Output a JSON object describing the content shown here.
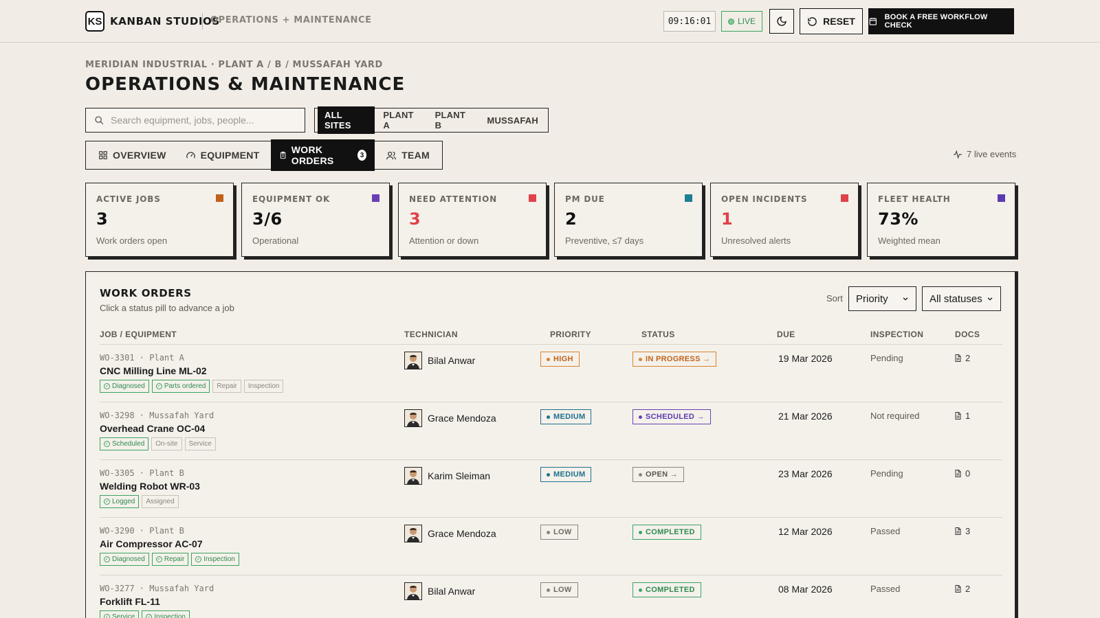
{
  "brand": {
    "logo": "KS",
    "name": "KANBAN STUDIOS",
    "section": "OPERATIONS + MAINTENANCE"
  },
  "topbar": {
    "clock": "09:16:01",
    "live": "LIVE",
    "reset": "RESET",
    "book": "BOOK A FREE WORKFLOW CHECK"
  },
  "breadcrumb": "MERIDIAN INDUSTRIAL · PLANT A / B / MUSSAFAH YARD",
  "title": "OPERATIONS & MAINTENANCE",
  "search": {
    "placeholder": "Search equipment, jobs, people..."
  },
  "sites": [
    "ALL SITES",
    "PLANT A",
    "PLANT B",
    "MUSSAFAH"
  ],
  "tabs": {
    "overview": "OVERVIEW",
    "equipment": "EQUIPMENT",
    "work_orders": "WORK ORDERS",
    "work_orders_count": "3",
    "team": "TEAM"
  },
  "live_events": "7 live events",
  "stats": [
    {
      "label": "ACTIVE JOBS",
      "value": "3",
      "sub": "Work orders open",
      "color": "#c0621a",
      "value_color": "#111111"
    },
    {
      "label": "EQUIPMENT OK",
      "value": "3/6",
      "sub": "Operational",
      "color": "#6a3fb5",
      "value_color": "#111111"
    },
    {
      "label": "NEED ATTENTION",
      "value": "3",
      "sub": "Attention or down",
      "color": "#e0424a",
      "value_color": "#e0424a"
    },
    {
      "label": "PM DUE",
      "value": "2",
      "sub": "Preventive, ≤7 days",
      "color": "#1f7f95",
      "value_color": "#111111"
    },
    {
      "label": "OPEN INCIDENTS",
      "value": "1",
      "sub": "Unresolved alerts",
      "color": "#e0424a",
      "value_color": "#e0424a"
    },
    {
      "label": "FLEET HEALTH",
      "value": "73%",
      "sub": "Weighted mean",
      "color": "#5a3bb0",
      "value_color": "#111111"
    }
  ],
  "work_orders": {
    "title": "WORK ORDERS",
    "subtitle": "Click a status pill to advance a job",
    "sort_label": "Sort",
    "sort_value": "Priority",
    "status_filter": "All statuses",
    "headers": {
      "job": "JOB / EQUIPMENT",
      "tech": "TECHNICIAN",
      "priority": "PRIORITY",
      "status": "STATUS",
      "due": "DUE",
      "inspection": "INSPECTION",
      "docs": "DOCS"
    },
    "rows": [
      {
        "id": "WO-3301 · Plant A",
        "name": "CNC Milling Line ML-02",
        "tags": [
          "Diagnosed",
          "Parts ordered",
          "Repair",
          "Inspection"
        ],
        "tech": "Bilal Anwar",
        "priority": "HIGH",
        "status": "IN PROGRESS →",
        "due": "19 Mar 2026",
        "inspection": "Pending",
        "docs": "2"
      },
      {
        "id": "WO-3298 · Mussafah Yard",
        "name": "Overhead Crane OC-04",
        "tags": [
          "Scheduled",
          "On-site",
          "Service"
        ],
        "tech": "Grace Mendoza",
        "priority": "MEDIUM",
        "status": "SCHEDULED →",
        "due": "21 Mar 2026",
        "inspection": "Not required",
        "docs": "1"
      },
      {
        "id": "WO-3305 · Plant B",
        "name": "Welding Robot WR-03",
        "tags": [
          "Logged",
          "Assigned"
        ],
        "tech": "Karim Sleiman",
        "priority": "MEDIUM",
        "status": "OPEN →",
        "due": "23 Mar 2026",
        "inspection": "Pending",
        "docs": "0"
      },
      {
        "id": "WO-3290 · Plant B",
        "name": "Air Compressor AC-07",
        "tags": [
          "Diagnosed",
          "Repair",
          "Inspection"
        ],
        "tech": "Grace Mendoza",
        "priority": "LOW",
        "status": "COMPLETED",
        "due": "12 Mar 2026",
        "inspection": "Passed",
        "docs": "3"
      },
      {
        "id": "WO-3277 · Mussafah Yard",
        "name": "Forklift FL-11",
        "tags": [
          "Service",
          "Inspection"
        ],
        "tech": "Bilal Anwar",
        "priority": "LOW",
        "status": "COMPLETED",
        "due": "08 Mar 2026",
        "inspection": "Passed",
        "docs": "2"
      }
    ]
  }
}
